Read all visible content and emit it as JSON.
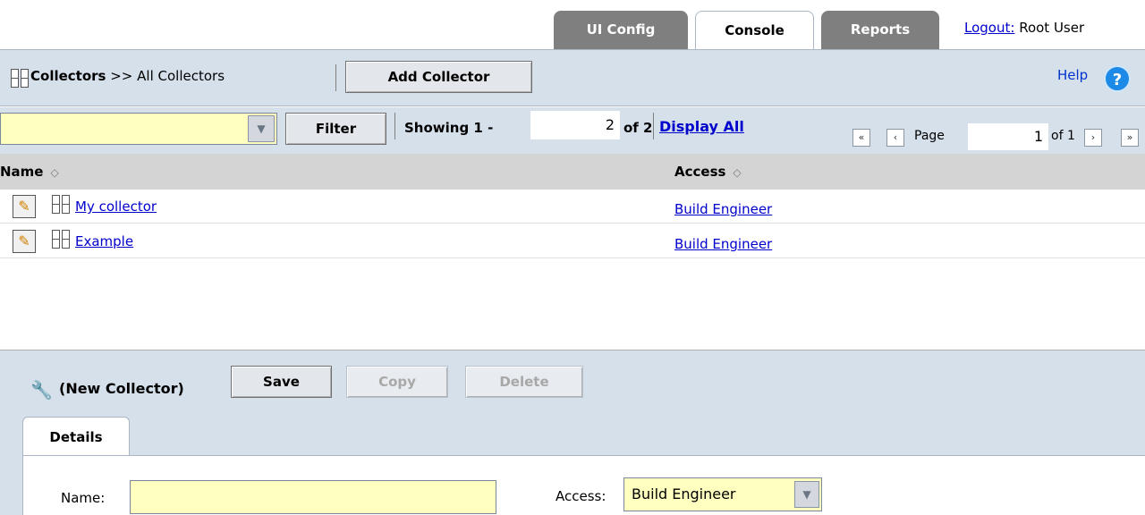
{
  "top_tabs": [
    {
      "label": "UI Config"
    },
    {
      "label": "Console"
    },
    {
      "label": "Reports"
    }
  ],
  "user": {
    "logout_label": "Logout:",
    "name": " Root User"
  },
  "header": {
    "section": "Collectors",
    "separator": " >> ",
    "current": "All Collectors",
    "add_button": "Add Collector",
    "help_label": "Help",
    "help_icon_glyph": "?"
  },
  "filter_bar": {
    "filter_value": "",
    "filter_button": "Filter",
    "showing_label": "Showing 1 -",
    "showing_count": "2",
    "of_total": "of 2",
    "display_all": "Display All",
    "page_label": "Page",
    "page_value": "1",
    "page_of": "of 1"
  },
  "table": {
    "columns": [
      "Name",
      "Access"
    ],
    "rows": [
      {
        "name": "My collector",
        "access": "Build Engineer"
      },
      {
        "name": "Example",
        "access": "Build Engineer"
      }
    ]
  },
  "detail": {
    "title": "(New Collector)",
    "save": "Save",
    "copy": "Copy",
    "delete": "Delete",
    "tab": "Details",
    "name_label": "Name:",
    "name_value": "",
    "access_label": "Access:",
    "access_value": "Build Engineer"
  },
  "colors": {
    "panel": "#d6e0eb",
    "input_yellow": "#ffffc0",
    "link": "#0000cc",
    "tab_dark": "#7f7f7f"
  }
}
